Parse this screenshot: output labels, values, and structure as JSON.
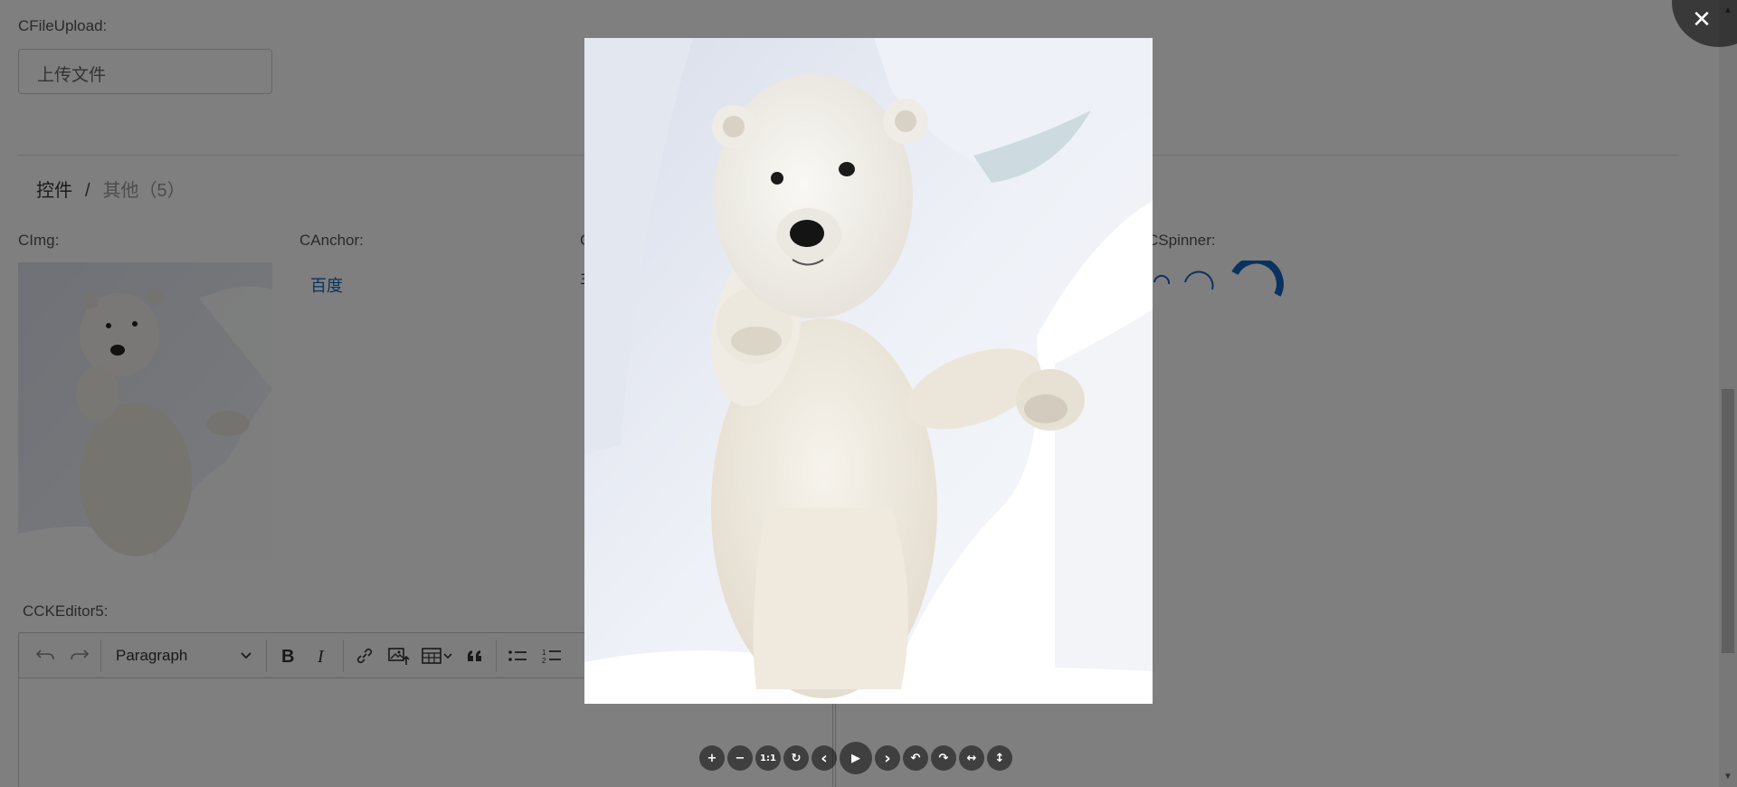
{
  "upload": {
    "label": "CFileUpload:",
    "button_label": "上传文件"
  },
  "breadcrumb": {
    "root": "控件",
    "separator": "/",
    "current": "其他（5）"
  },
  "components": {
    "img_label": "CImg:",
    "anchor_label": "CAnchor:",
    "anchor_link_text": "百度",
    "hidden_label": "C",
    "hidden_value": "主",
    "spinner_label": "CSpinner:"
  },
  "editor": {
    "label": "CCKEditor5:",
    "paragraph_select": "Paragraph",
    "toolbar_icons": [
      "undo-icon",
      "redo-icon",
      "bold-icon",
      "italic-icon",
      "link-icon",
      "insert-image-icon",
      "table-icon",
      "blockquote-icon",
      "bulleted-list-icon",
      "numbered-list-icon"
    ]
  },
  "viewer": {
    "close_symbol": "✕",
    "toolbar": [
      {
        "name": "zoom-in-button",
        "symbol": "+"
      },
      {
        "name": "zoom-out-button",
        "symbol": "−"
      },
      {
        "name": "one-to-one-button",
        "symbol": "1:1"
      },
      {
        "name": "reset-button",
        "symbol": "↻"
      },
      {
        "name": "prev-button",
        "symbol": "‹"
      },
      {
        "name": "play-button",
        "symbol": "▶"
      },
      {
        "name": "next-button",
        "symbol": "›"
      },
      {
        "name": "rotate-left-button",
        "symbol": "↶"
      },
      {
        "name": "rotate-right-button",
        "symbol": "↷"
      },
      {
        "name": "flip-horizontal-button",
        "symbol": "↔"
      },
      {
        "name": "flip-vertical-button",
        "symbol": "↕"
      }
    ]
  },
  "colors": {
    "overlay": "#000000",
    "link": "#1565c0",
    "spinner": "#1565c0"
  }
}
